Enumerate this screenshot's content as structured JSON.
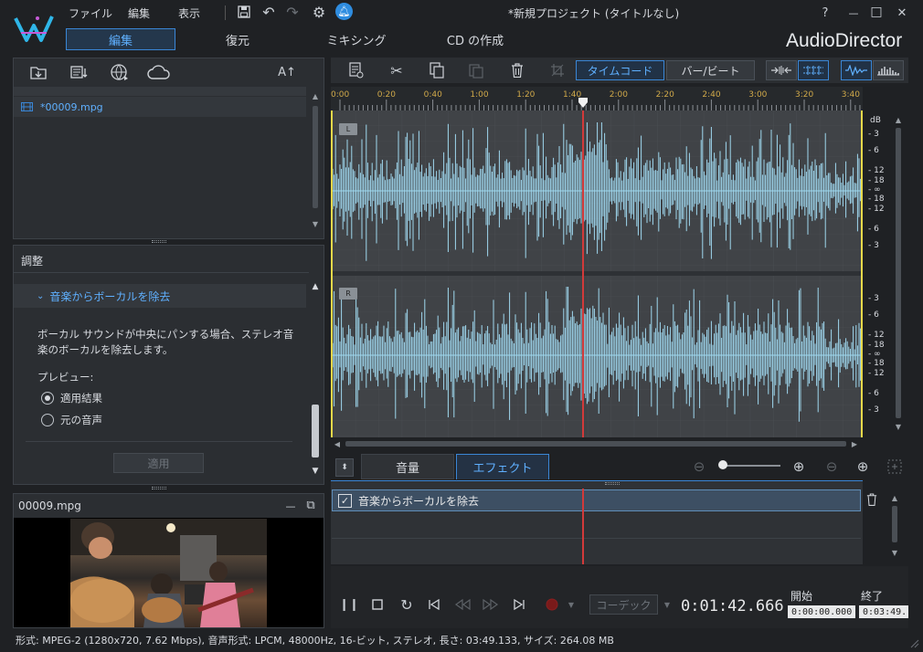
{
  "title_bar": {
    "menus": [
      "ファイル",
      "編集",
      "表示"
    ],
    "window_title": "*新規プロジェクト (タイトルなし)",
    "help": "?",
    "minimize": "—",
    "maximize": "□",
    "close": "✕"
  },
  "modes": {
    "tabs": [
      "編集",
      "復元",
      "ミキシング",
      "CD の作成"
    ],
    "active": "編集"
  },
  "brand": "AudioDirector",
  "library": {
    "sort_label": "A↑",
    "file_item": "*00009.mpg"
  },
  "adjust": {
    "title": "調整",
    "section": "音楽からボーカルを除去",
    "description": "ボーカル サウンドが中央にパンする場合、ステレオ音楽のボーカルを除去します。",
    "preview_label": "プレビュー:",
    "options": [
      "適用結果",
      "元の音声"
    ],
    "selected_option": "適用結果",
    "apply_button": "適用"
  },
  "preview": {
    "filename": "00009.mpg",
    "minimize": "—",
    "expand": "⧉"
  },
  "toolbar": {
    "timecode_label": "タイムコード",
    "bar_beat_label": "バー/ビート"
  },
  "ruler": {
    "labels": [
      "0:00",
      "0:20",
      "0:40",
      "1:00",
      "1:20",
      "1:40",
      "2:00",
      "2:20",
      "2:40",
      "3:00",
      "3:20",
      "3:40"
    ]
  },
  "channels": {
    "left": "L",
    "right": "R",
    "db_unit": "dB"
  },
  "db_scale_left": [
    "-3",
    "-6",
    "-12",
    "-18",
    "-∞",
    "-18",
    "-12",
    "-6",
    "-3"
  ],
  "db_scale_right": [
    "-3",
    "-6",
    "-12",
    "-18",
    "-∞",
    "-18",
    "-12",
    "-6",
    "-3"
  ],
  "bottom_tabs": {
    "volume": "音量",
    "effect": "エフェクト",
    "active": "エフェクト"
  },
  "effects": [
    {
      "name": "音楽からボーカルを除去",
      "enabled": true
    }
  ],
  "transport": {
    "codec": "コーデック",
    "current_time": "0:01:42.666",
    "start_label": "開始",
    "end_label": "終了",
    "start_value": "0:00:00.000",
    "end_value": "0:03:49."
  },
  "status_bar": "形式: MPEG-2 (1280x720, 7.62 Mbps), 音声形式: LPCM, 48000Hz, 16-ビット, ステレオ, 長さ: 03:49.133, サイズ: 264.08 MB",
  "colors": {
    "accent": "#3a86d6",
    "waveform": "#9fd8ef",
    "playhead": "#d23a3a",
    "ruler_text": "#d0a94a",
    "selection_edge": "#e6d84a"
  },
  "audio": {
    "duration_seconds": 229.133,
    "playhead_seconds": 102.666
  }
}
